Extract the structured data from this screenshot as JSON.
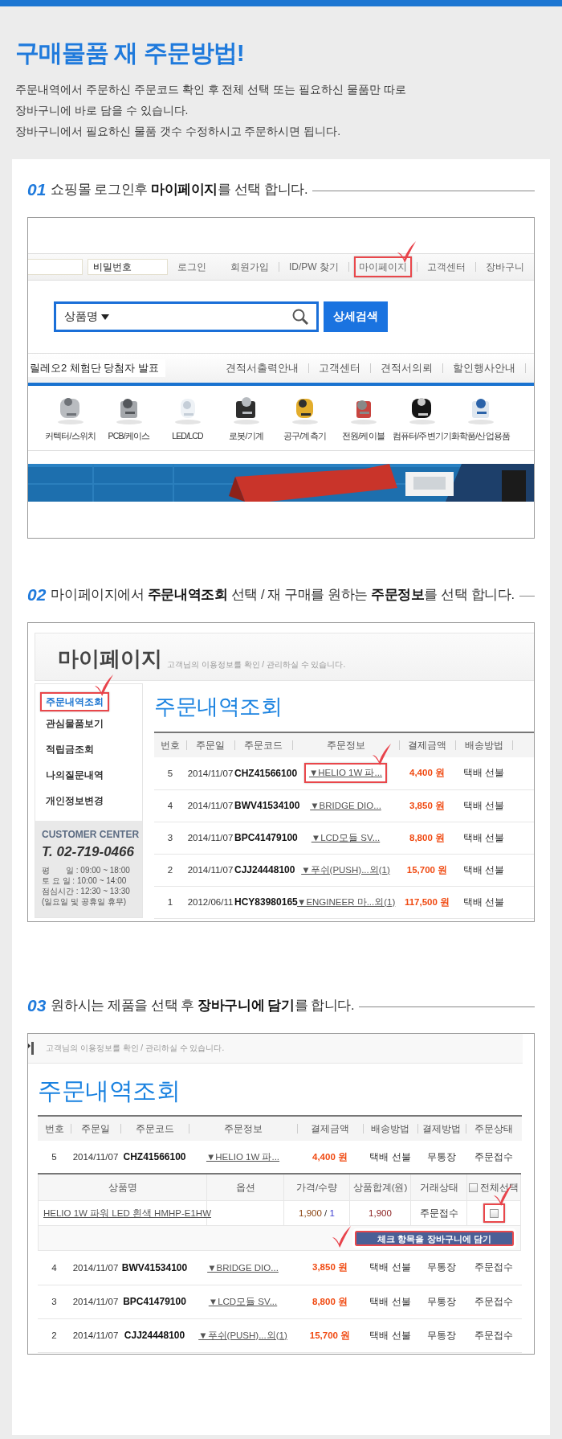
{
  "title": "구매물품 재 주문방법!",
  "intro": [
    "주문내역에서 주문하신  주문코드 확인 후 전체 선택 또는 필요하신 물품만 따로",
    "장바구니에 바로 담을 수 있습니다.",
    "장바구니에서 필요하신 물품 갯수 수정하시고 주문하시면 됩니다."
  ],
  "steps": [
    {
      "number": "01",
      "text": "쇼핑몰 로그인후 **마이페이지**를 선택 합니다.",
      "screen": {
        "kind": "shop_home",
        "login": {
          "password_placeholder": "비밀번호",
          "login_link": "로그인",
          "links": [
            {
              "label": "회원가입",
              "highlighted": false
            },
            {
              "label": "ID/PW 찾기",
              "highlighted": false
            },
            {
              "label": "마이페이지",
              "highlighted": true
            },
            {
              "label": "고객센터",
              "highlighted": false
            },
            {
              "label": "장바구니",
              "highlighted": false
            }
          ]
        },
        "search": {
          "category": "상품명",
          "button": "상세검색"
        },
        "notice": "릴레오2 체험단 당첨자 발표",
        "menu": [
          "견적서출력안내",
          "고객센터",
          "견적서의뢰",
          "할인행사안내"
        ],
        "categories": [
          "커텍터/스위치",
          "PCB/케이스",
          "LED/LCD",
          "로봇/기계",
          "공구/계측기",
          "전원/케이블",
          "컴퓨터/주변기기",
          "화학품/산업용품"
        ]
      }
    },
    {
      "number": "02",
      "text": "마이페이지에서 **주문내역조회** 선택 / 재 구매를 원하는 **주문정보**를 선택 합니다.",
      "screen": {
        "kind": "mypage",
        "heading": "마이페이지",
        "subtitle": "고객님의 이용정보를 확인 / 관리하실 수 있습니다.",
        "sidebar": [
          {
            "label": "주문내역조회",
            "selected": true,
            "highlighted": true
          },
          {
            "label": "관심물품보기",
            "selected": false,
            "highlighted": false
          },
          {
            "label": "적립금조회",
            "selected": false,
            "highlighted": false
          },
          {
            "label": "나의질문내역",
            "selected": false,
            "highlighted": false
          },
          {
            "label": "개인정보변경",
            "selected": false,
            "highlighted": false
          }
        ],
        "customer_center": {
          "title": "CUSTOMER CENTER",
          "phone": "T. 02-719-0466",
          "hours": [
            "평　　일 : 09:00 ~ 18:00",
            "토 요 일 : 10:00 ~ 14:00",
            "점심시간 : 12:30 ~ 13:30",
            "(일요일 및 공휴일 휴무)"
          ]
        },
        "page_title": "주문내역조회",
        "columns": [
          "번호",
          "주문일",
          "주문코드",
          "주문정보",
          "결제금액",
          "배송방법"
        ],
        "rows": [
          {
            "number": "5",
            "date": "2014/11/07",
            "code": "CHZ41566100",
            "info": "▼HELIO 1W 파...",
            "info_highlighted": true,
            "amount": "4,400 원",
            "shipping": "택배 선불"
          },
          {
            "number": "4",
            "date": "2014/11/07",
            "code": "BWV41534100",
            "info": "▼BRIDGE DIO...",
            "info_highlighted": false,
            "amount": "3,850 원",
            "shipping": "택배 선불"
          },
          {
            "number": "3",
            "date": "2014/11/07",
            "code": "BPC41479100",
            "info": "▼LCD모듈 SV...",
            "info_highlighted": false,
            "amount": "8,800 원",
            "shipping": "택배 선불"
          },
          {
            "number": "2",
            "date": "2014/11/07",
            "code": "CJJ24448100",
            "info": "▼푸쉬(PUSH)...외(1)",
            "info_highlighted": false,
            "amount": "15,700 원",
            "shipping": "택배 선불"
          },
          {
            "number": "1",
            "date": "2012/06/11",
            "code": "HCY83980165",
            "info": "▼ENGINEER 마...외(1)",
            "info_highlighted": false,
            "amount": "117,500 원",
            "shipping": "택배 선불"
          }
        ]
      }
    },
    {
      "number": "03",
      "text": "원하시는 제품을 선택 후 **장바구니에 담기**를 합니다.",
      "screen": {
        "kind": "order_detail",
        "subtitle": "고객님의 이용정보를 확인 / 관리하실 수 있습니다.",
        "page_title": "주문내역조회",
        "columns": [
          "번호",
          "주문일",
          "주문코드",
          "주문정보",
          "결제금액",
          "배송방법",
          "결제방법",
          "주문상태"
        ],
        "rows": [
          {
            "number": "5",
            "date": "2014/11/07",
            "code": "CHZ41566100",
            "info": "▼HELIO 1W 파...",
            "amount": "4,400 원",
            "shipping": "택배 선불",
            "payment": "무통장",
            "status": "주문접수",
            "detail": {
              "columns": [
                "상품명",
                "옵션",
                "가격/수량",
                "상품합계(원)",
                "거래상태"
              ],
              "select_all": {
                "label": "전체선택",
                "checked": false
              },
              "items": [
                {
                  "name": "HELIO 1W 파워 LED 흰색 HMHP-E1HW",
                  "price": "1,900",
                  "separator": "/",
                  "quantity": "1",
                  "total": "1,900",
                  "status": "주문접수",
                  "checked": false,
                  "highlighted": true
                }
              ],
              "button": {
                "label": "체크 항목을 장바구니에 담기",
                "highlighted": true
              }
            }
          },
          {
            "number": "4",
            "date": "2014/11/07",
            "code": "BWV41534100",
            "info": "▼BRIDGE DIO...",
            "amount": "3,850 원",
            "shipping": "택배 선불",
            "payment": "무통장",
            "status": "주문접수"
          },
          {
            "number": "3",
            "date": "2014/11/07",
            "code": "BPC41479100",
            "info": "▼LCD모듈 SV...",
            "amount": "8,800 원",
            "shipping": "택배 선불",
            "payment": "무통장",
            "status": "주문접수"
          },
          {
            "number": "2",
            "date": "2014/11/07",
            "code": "CJJ24448100",
            "info": "▼푸쉬(PUSH)...외(1)",
            "amount": "15,700 원",
            "shipping": "택배 선불",
            "payment": "무통장",
            "status": "주문접수"
          }
        ]
      }
    }
  ]
}
